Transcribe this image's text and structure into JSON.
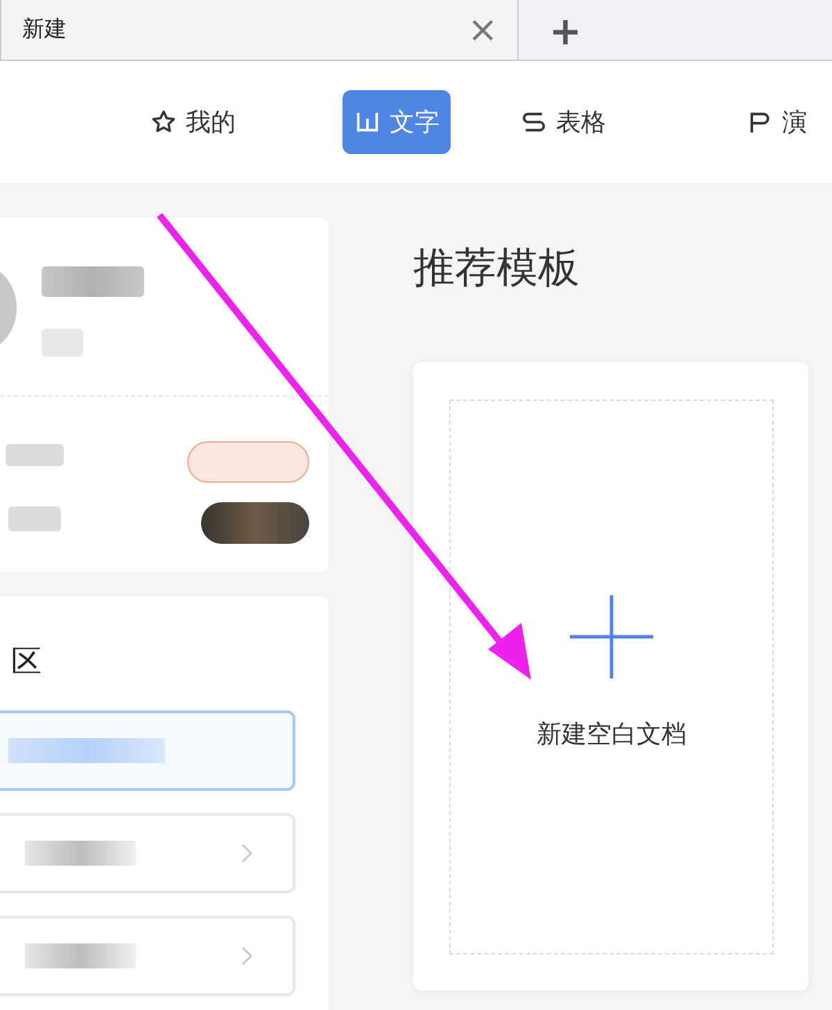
{
  "browser_tab": {
    "title": "新建",
    "close": "×",
    "new_tab": "+"
  },
  "nav": [
    {
      "kind": "star",
      "label": "我的",
      "selected": false
    },
    {
      "kind": "writer",
      "label": "文字",
      "selected": true
    },
    {
      "kind": "sheet",
      "label": "表格",
      "selected": false
    },
    {
      "kind": "slides",
      "label": "演",
      "selected": false
    }
  ],
  "zone": {
    "title": "区",
    "items": [
      {
        "selected": true
      },
      {
        "selected": false
      },
      {
        "selected": false
      }
    ]
  },
  "templates": {
    "title": "推荐模板",
    "new_blank": "新建空白文档"
  }
}
